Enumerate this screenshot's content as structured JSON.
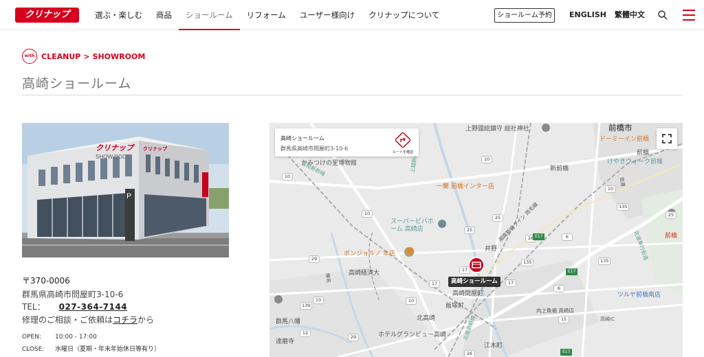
{
  "header": {
    "logo_text": "クリナップ",
    "nav": [
      {
        "label": "選ぶ・楽しむ",
        "active": false
      },
      {
        "label": "商品",
        "active": false
      },
      {
        "label": "ショールーム",
        "active": true
      },
      {
        "label": "リフォーム",
        "active": false
      },
      {
        "label": "ユーザー様向け",
        "active": false
      },
      {
        "label": "クリナップについて",
        "active": false
      }
    ],
    "reserve_label": "ショールーム予約",
    "lang_en": "ENGLISH",
    "lang_zh": "繁體中文",
    "icons": {
      "search": "search-icon",
      "menu": "hamburger-menu-icon"
    },
    "accent_color": "#d7001e"
  },
  "breadcrumb": {
    "badge": "with",
    "brand": "CLEANUP",
    "separator": ">",
    "section": "SHOWROOM"
  },
  "page_title": "高崎ショールーム",
  "info": {
    "postal": "〒370-0006",
    "address": "群馬県高崎市問屋町3-10-6",
    "tel_label": "TEL：",
    "tel_number": "027-364-7144",
    "repair_prefix": "修理のご相談・ご依頼は",
    "repair_link": "コチラ",
    "repair_suffix": "から",
    "hours": [
      {
        "label": "OPEN:",
        "value": "10:00 - 17:00"
      },
      {
        "label": "CLOSE:",
        "value": "水曜日（夏期・年末年始休日等有り）"
      }
    ]
  },
  "photo": {
    "sign_1": "クリナップ",
    "sign_2": "SHOW ROOM",
    "sign_3": "クリナップ",
    "letter": "P"
  },
  "map": {
    "popup_name": "高崎ショールーム",
    "popup_address": "群馬県高崎市問屋町3-10-6",
    "route_label": "ルートを確認",
    "pin_label": "高崎ショールーム",
    "labels": [
      {
        "text": "前橋市",
        "style": "big"
      },
      {
        "text": "上野國総鎮守 総社神社",
        "style": "dark"
      },
      {
        "text": "ドーミーイン前橋",
        "style": "orange"
      },
      {
        "text": "前橋",
        "style": "dark"
      },
      {
        "text": "けやきウォーク前橋",
        "style": "teal"
      },
      {
        "text": "かみつけの里博物館",
        "style": "dark"
      },
      {
        "text": "新前橋",
        "style": "dark"
      },
      {
        "text": "一蘭 前橋インター店",
        "style": "orange"
      },
      {
        "text": "スーパービバホーム 高崎店",
        "style": "teal"
      },
      {
        "text": "ボンジョルノ 本店",
        "style": "orange"
      },
      {
        "text": "井野",
        "style": "dark"
      },
      {
        "text": "高崎経済大",
        "style": "dark"
      },
      {
        "text": "高崎問屋町",
        "style": "dark"
      },
      {
        "text": "飯塚町",
        "style": "dark"
      },
      {
        "text": "北高崎",
        "style": "dark"
      },
      {
        "text": "群馬八幡",
        "style": "dark"
      },
      {
        "text": "達磨寺",
        "style": "dark"
      },
      {
        "text": "ホテルグランビュー高崎",
        "style": "dark"
      },
      {
        "text": "江木町",
        "style": "dark"
      },
      {
        "text": "ツルヤ前橋南店",
        "style": "blue"
      },
      {
        "text": "向上魚福 高崎店",
        "style": "dark"
      },
      {
        "text": "前橋",
        "style": "red"
      },
      {
        "text": "北陸新幹線",
        "style": "rail"
      },
      {
        "text": "上越新幹線",
        "style": "rail"
      },
      {
        "text": "北陸新幹線",
        "style": "rail"
      },
      {
        "text": "湘南新宿ライン 両毛線",
        "style": "dark"
      },
      {
        "text": "佐渡奉行街道",
        "style": "rail"
      },
      {
        "text": "高崎IC",
        "style": "dark"
      },
      {
        "text": "榛名",
        "style": "dark"
      },
      {
        "text": "佐渡",
        "style": "dark"
      }
    ],
    "shields": [
      "10",
      "10",
      "10",
      "25",
      "25",
      "25",
      "17",
      "17",
      "17",
      "10",
      "29",
      "29",
      "15",
      "135",
      "135",
      "135",
      "139",
      "26",
      "26",
      "6",
      "6",
      "12",
      "10",
      "10"
    ],
    "highway_shields": [
      "E17",
      "E17",
      "E17"
    ]
  }
}
